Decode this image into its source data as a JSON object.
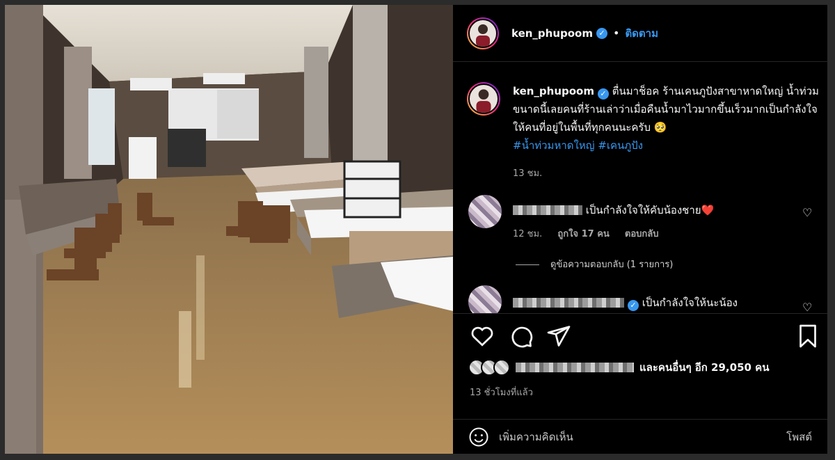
{
  "post": {
    "username": "ken_phupoom",
    "follow_label": "ติดตาม",
    "dot": "•",
    "caption": {
      "username": "ken_phupoom",
      "text": "ตื่นมาช็อค ร้านเคนภูปังสาขาหาดใหญ่ น้ำท่วมขนาดนี้เลยคนที่ร้านเล่าว่าเมื่อคืนน้ำมาไวมากขึ้นเร็วมากเป็นกำลังใจให้คนที่อยู่ในพื้นที่ทุกคนนะครับ 🥺",
      "hashtags": "#น้ำท่วมหาดใหญ่ #เคนภูปัง",
      "time": "13 ชม."
    },
    "comments": [
      {
        "text": "เป็นกำลังใจให้คับน้องชาย❤️",
        "time": "12 ชม.",
        "likes": "ถูกใจ 17 คน",
        "reply_label": "ตอบกลับ",
        "view_replies": "ดูข้อความตอบกลับ (1 รายการ)"
      },
      {
        "text": "เป็นกำลังใจให้นะน้อง"
      }
    ],
    "likes_text": "และคนอื่นๆ อีก 29,050 คน",
    "posted_time": "13 ชั่วโมงที่แล้ว",
    "comment_placeholder": "เพิ่มความคิดเห็น",
    "post_button": "โพสต์"
  },
  "icons": {
    "like": "heart-icon",
    "comment": "comment-icon",
    "share": "share-icon",
    "save": "bookmark-icon",
    "emoji": "emoji-icon",
    "verified": "verified-badge-icon"
  },
  "colors": {
    "accent": "#3897f0",
    "background": "#000000",
    "muted_text": "#a8a8a8"
  }
}
